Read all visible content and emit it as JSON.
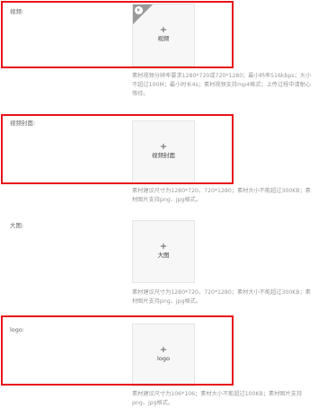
{
  "fields": {
    "video": {
      "label": "视频:",
      "upload_text": "视频",
      "hint": "素材视频分辨率要求1280*720或720*1280；最小码率516kbps；大小不超过100M；最小时长4s；素材视频支持mp4格式；上传过程中请耐心等待。"
    },
    "video_cover": {
      "label": "视频封面:",
      "upload_text": "视频封面",
      "hint": "素材建议尺寸为1280*720、720*1280；素材大小不能超过300KB；素材图片支持png、jpg格式。"
    },
    "big_image": {
      "label": "大图:",
      "upload_text": "大图",
      "hint": "素材建议尺寸为1280*720、720*1280；素材大小不能超过300KB；素材图片支持png、jpg格式。"
    },
    "logo": {
      "label": "logo:",
      "upload_text": "logo",
      "hint": "素材建议尺寸为106*106；素材大小不能超过100KB；素材图片支持png、jpg格式。"
    }
  },
  "plus_glyph": "+",
  "icons": {
    "video_corner": "play-icon"
  },
  "colors": {
    "highlight": "#e8141b",
    "hint_text": "#999999",
    "upload_bg": "#f7f7f7"
  }
}
